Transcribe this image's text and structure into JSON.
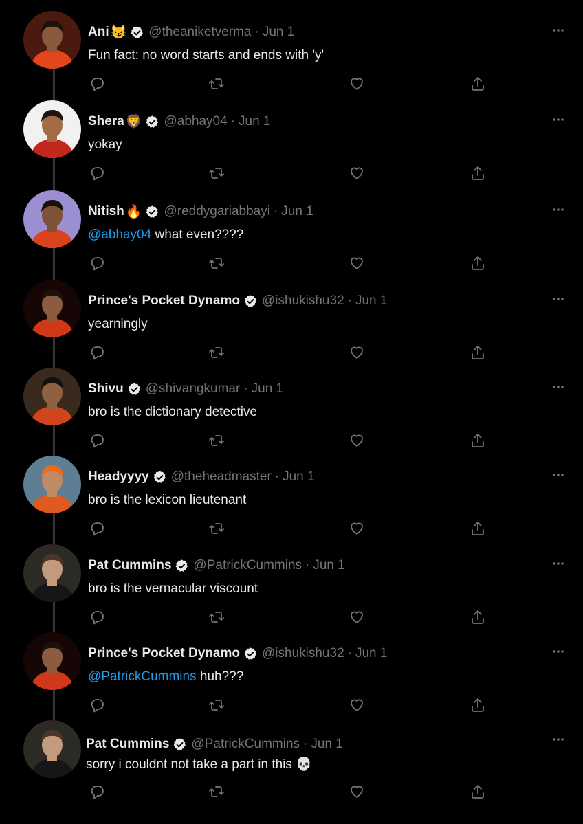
{
  "colors": {
    "background": "#000000",
    "text": "#e7e9ea",
    "muted": "#71767b",
    "link": "#1d9bf0",
    "thread_line": "#333639"
  },
  "tweets": [
    {
      "name": "Ani",
      "emoji": "😼",
      "handle": "@theaniketverma",
      "sep": "·",
      "date": "Jun 1",
      "mention": "",
      "text": "Fun fact: no word starts and ends with 'y'",
      "avatar": {
        "bg": "#4a1a10",
        "shirt": "#e2461b",
        "skin": "#8a5a3c",
        "hair": "#1b120c"
      }
    },
    {
      "name": "Shera",
      "emoji": "🦁",
      "handle": "@abhay04",
      "sep": "·",
      "date": "Jun 1",
      "mention": "",
      "text": "yokay",
      "avatar": {
        "bg": "#f1f1f1",
        "shirt": "#c1271a",
        "skin": "#a36b46",
        "hair": "#1d140f"
      }
    },
    {
      "name": "Nitish",
      "emoji": "🔥",
      "handle": "@reddygariabbayi",
      "sep": "·",
      "date": "Jun 1",
      "mention": "@abhay04",
      "text": "what even????",
      "avatar": {
        "bg": "#9c8fd1",
        "shirt": "#d9431e",
        "skin": "#7e5237",
        "hair": "#17100b"
      }
    },
    {
      "name": "Prince's Pocket Dynamo",
      "emoji": "",
      "handle": "@ishukishu32",
      "sep": "·",
      "date": "Jun 1",
      "mention": "",
      "text": "yearningly",
      "avatar": {
        "bg": "#150605",
        "shirt": "#d0381a",
        "skin": "#8b5c3f",
        "hair": "#1a110c"
      }
    },
    {
      "name": "Shivu",
      "emoji": "",
      "handle": "@shivangkumar",
      "sep": "·",
      "date": "Jun 1",
      "mention": "",
      "text": "bro is the dictionary detective",
      "avatar": {
        "bg": "#3a2a1d",
        "shirt": "#d2451c",
        "skin": "#8f6142",
        "hair": "#150f0b"
      }
    },
    {
      "name": "Headyyyy",
      "emoji": "",
      "handle": "@theheadmaster",
      "sep": "·",
      "date": "Jun 1",
      "mention": "",
      "text": "bro is the lexicon lieutenant",
      "avatar": {
        "bg": "#5e7f93",
        "shirt": "#e05a1f",
        "skin": "#c08a66",
        "hair": "#ec6a1c"
      }
    },
    {
      "name": "Pat Cummins",
      "emoji": "",
      "handle": "@PatrickCummins",
      "sep": "·",
      "date": "Jun 1",
      "mention": "",
      "text": "bro is the vernacular viscount",
      "avatar": {
        "bg": "#2c2a25",
        "shirt": "#161616",
        "skin": "#c49a7c",
        "hair": "#4a3526"
      }
    },
    {
      "name": "Prince's Pocket Dynamo",
      "emoji": "",
      "handle": "@ishukishu32",
      "sep": "·",
      "date": "Jun 1",
      "mention": "@PatrickCummins",
      "text": "huh???",
      "avatar": {
        "bg": "#150605",
        "shirt": "#d0381a",
        "skin": "#8b5c3f",
        "hair": "#1a110c"
      }
    },
    {
      "name": "Pat Cummins",
      "emoji": "",
      "handle": "@PatrickCummins",
      "sep": "·",
      "date": "Jun 1",
      "mention": "",
      "text": "sorry i couldnt not take a part in this 💀",
      "avatar": {
        "bg": "#2c2a25",
        "shirt": "#161616",
        "skin": "#c49a7c",
        "hair": "#4a3526"
      }
    }
  ]
}
